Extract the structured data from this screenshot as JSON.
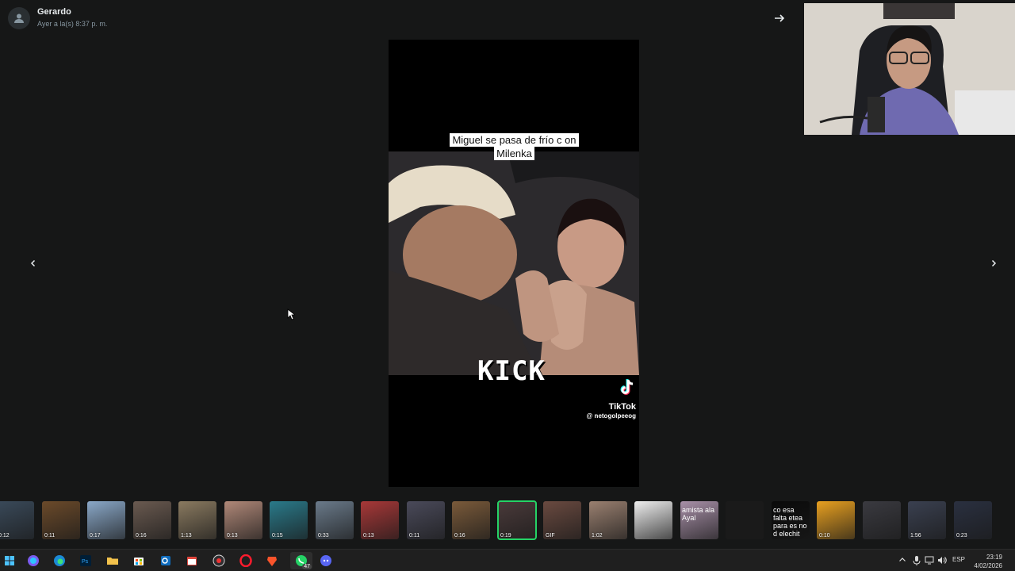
{
  "viewer": {
    "sender_name": "Gerardo",
    "timestamp": "Ayer a la(s) 8:37 p. m."
  },
  "video": {
    "caption": "Miguel se pasa de frío c on Milenka",
    "overlay_text": "KICK",
    "tiktok_brand": "TikTok",
    "tiktok_handle": "@ netogolpeeog"
  },
  "thumbnails": [
    {
      "duration": "0:12",
      "color": "#3a4a5a"
    },
    {
      "duration": "0:11",
      "color": "#6b4a2a"
    },
    {
      "duration": "0:17",
      "color": "#8aa8c8"
    },
    {
      "duration": "0:16",
      "color": "#6a5a50"
    },
    {
      "duration": "1:13",
      "color": "#8a7a60"
    },
    {
      "duration": "0:13",
      "color": "#b08878"
    },
    {
      "duration": "0:15",
      "color": "#2a7a8a"
    },
    {
      "duration": "0:33",
      "color": "#6a7a8a"
    },
    {
      "duration": "0:13",
      "color": "#a83838"
    },
    {
      "duration": "0:11",
      "color": "#4a4a5a"
    },
    {
      "duration": "0:16",
      "color": "#7a5a3a"
    },
    {
      "duration": "0:19",
      "color": "#4a3a3a",
      "selected": true
    },
    {
      "duration": "GIF",
      "color": "#6a4a40"
    },
    {
      "duration": "1:02",
      "color": "#9a8070"
    },
    {
      "duration": "",
      "color": "#eeeeee"
    },
    {
      "duration": "",
      "color": "#a890a8",
      "text": "amista ala Ayal"
    },
    {
      "duration": "",
      "color": "#1a1a1a"
    },
    {
      "duration": "",
      "color": "#0a0a0a",
      "text": "co esa falta etea para es no d elechit"
    },
    {
      "duration": "0:10",
      "color": "#e8a020"
    },
    {
      "duration": "",
      "color": "#3a3a40"
    },
    {
      "duration": "1:56",
      "color": "#3a4050"
    },
    {
      "duration": "0:23",
      "color": "#2a3040"
    }
  ],
  "taskbar": {
    "language": "ESP",
    "time": "23:19",
    "date": "4/02/2026",
    "badge": "47"
  }
}
